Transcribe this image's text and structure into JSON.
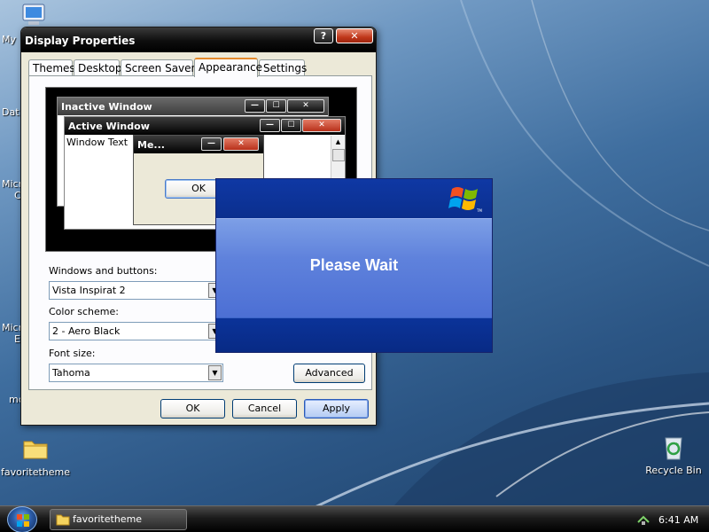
{
  "desktop": {
    "icons": [
      {
        "label": "favoritetheme",
        "icon": "folder-icon"
      },
      {
        "label": "Recycle Bin",
        "icon": "recycle-bin-icon"
      }
    ],
    "cut_labels": [
      "My",
      "Dat",
      "Micr",
      "C",
      "Micr",
      "E",
      "mc"
    ]
  },
  "display_properties": {
    "title": "Display Properties",
    "help_glyph": "?",
    "close_glyph": "✕",
    "tabs": [
      "Themes",
      "Desktop",
      "Screen Saver",
      "Appearance",
      "Settings"
    ],
    "active_tab": "Appearance",
    "preview": {
      "inactive_title": "Inactive Window",
      "active_title": "Active Window",
      "window_text": "Window Text",
      "message_title": "Me...",
      "ok_label": "OK",
      "min_glyph": "—",
      "max_glyph": "☐",
      "close_glyph": "✕"
    },
    "windows_buttons_label": "Windows and buttons:",
    "windows_buttons_value": "Vista Inspirat 2",
    "color_scheme_label": "Color scheme:",
    "color_scheme_value": "2 - Aero Black",
    "font_size_label": "Font size:",
    "font_size_value": "Tahoma",
    "advanced_label": "Advanced",
    "ok_label": "OK",
    "cancel_label": "Cancel",
    "apply_label": "Apply"
  },
  "wait_dialog": {
    "message": "Please Wait"
  },
  "taskbar": {
    "task_label": "favoritetheme",
    "clock": "6:41 AM"
  },
  "colors": {
    "xp_blue": "#0f38a4",
    "accent_orange": "#e68b2c",
    "close_red": "#c0371a"
  }
}
